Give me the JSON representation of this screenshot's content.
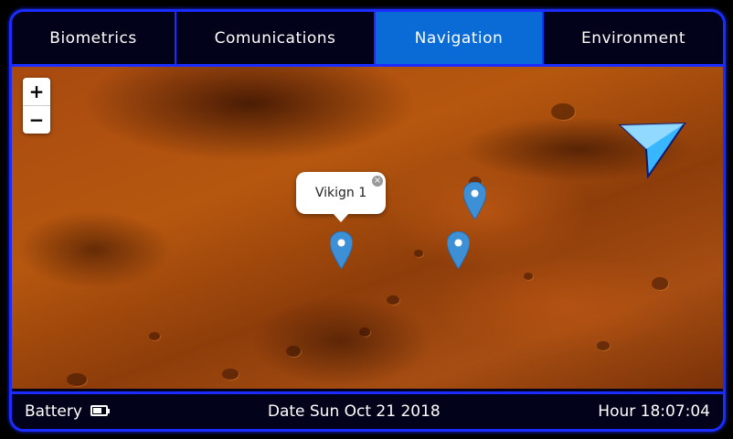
{
  "tabs": [
    {
      "label": "Biometrics",
      "active": false
    },
    {
      "label": "Comunications",
      "active": false
    },
    {
      "label": "Navigation",
      "active": true
    },
    {
      "label": "Environment",
      "active": false
    }
  ],
  "map": {
    "zoom_in_label": "+",
    "zoom_out_label": "−",
    "popup": {
      "label": "Vikign 1",
      "close_label": "×"
    },
    "marker_color": "#3d8fd6",
    "arrow_color": "#38b6ff"
  },
  "status": {
    "battery_label": "Battery",
    "date_label": "Date Sun Oct 21 2018",
    "hour_label": "Hour 18:07:04"
  },
  "colors": {
    "accent": "#1a2cff",
    "active_tab": "#0a6bd6",
    "background": "#02021a"
  }
}
